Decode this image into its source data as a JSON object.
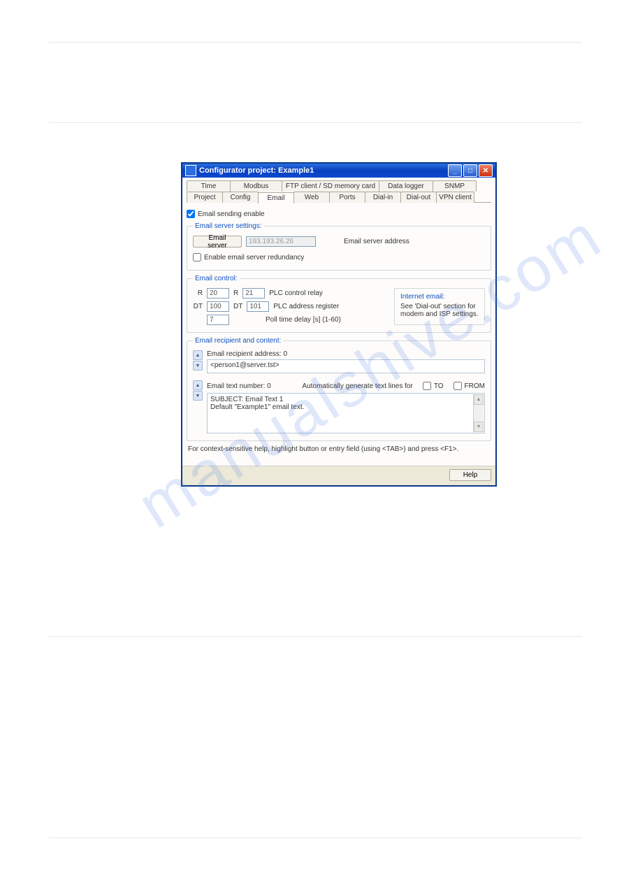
{
  "watermark": "manualshive.com",
  "window": {
    "title": "Configurator project: Example1",
    "tabs_row1": [
      "Time",
      "Modbus",
      "FTP client / SD memory card",
      "Data logger",
      "SNMP"
    ],
    "tabs_row2": [
      "Project",
      "Config",
      "Email",
      "Web",
      "Ports",
      "Dial-in",
      "Dial-out",
      "VPN client"
    ],
    "active_tab": "Email"
  },
  "email_enable": {
    "label": "Email sending enable",
    "checked": true
  },
  "server_settings": {
    "legend": "Email server settings:",
    "button": "Email server",
    "address_value": "193.193.26.26",
    "address_label": "Email server address",
    "redundancy_label": "Enable email server redundancy",
    "redundancy_checked": false
  },
  "email_control": {
    "legend": "Email control:",
    "r_label": "R",
    "r_val1": "20",
    "r_val2": "21",
    "r_desc": "PLC control relay",
    "dt_label": "DT",
    "dt_val1": "100",
    "dt_val2": "101",
    "dt_desc": "PLC address register",
    "poll_val": "7",
    "poll_desc": "Poll time delay [s]   (1-60)",
    "internet_title": "Internet email:",
    "internet_text1": "See 'Dial-out' section for",
    "internet_text2": "modem and ISP settings."
  },
  "recipient": {
    "legend": "Email recipient and content:",
    "addr_label": "Email recipient address: 0",
    "addr_value": "<person1@server.tst>",
    "textnum_label": "Email text number: 0",
    "autogen_label": "Automatically generate text lines for",
    "to_label": "TO",
    "from_label": "FROM",
    "body_line1": "SUBJECT: Email Text 1",
    "body_line2": "Default \"Example1\" email text."
  },
  "hint": "For context-sensitive help, highlight button or entry field (using <TAB>) and press <F1>.",
  "help_btn": "Help"
}
